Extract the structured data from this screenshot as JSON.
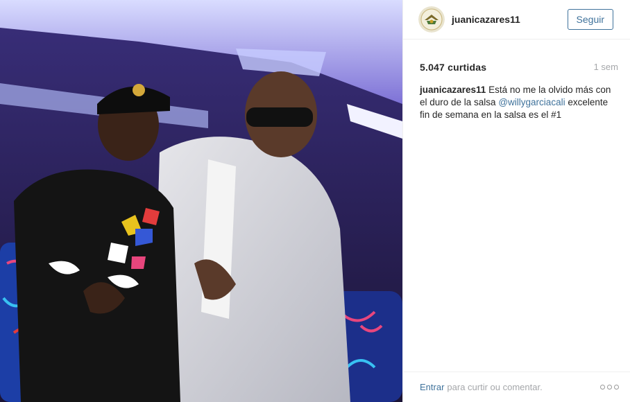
{
  "post": {
    "username": "juanicazares11",
    "follow_label": "Seguir",
    "likes": "5.047 curtidas",
    "time": "1 sem",
    "caption": {
      "user": "juanicazares11",
      "text_before": "Está no me la olvido más con el duro de la salsa",
      "mention": "@willygarciacali",
      "text_after": "excelente fin de semana en la salsa es el #1"
    },
    "footer": {
      "login_link": "Entrar",
      "rest": "para curtir ou comentar."
    }
  },
  "colors": {
    "link": "#3f729b",
    "muted": "#a5a7aa",
    "border": "#efefef"
  },
  "icons": {
    "avatar": "avatar-emblem-icon",
    "more": "more-options-icon"
  }
}
